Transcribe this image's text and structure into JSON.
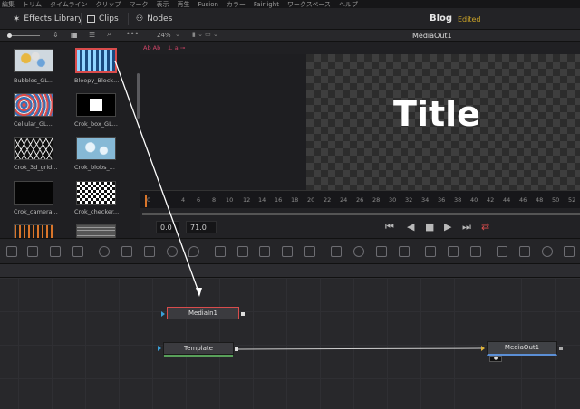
{
  "menu": [
    "編集",
    "トリム",
    "タイムライン",
    "クリップ",
    "マーク",
    "表示",
    "再生",
    "Fusion",
    "カラー",
    "Fairlight",
    "ワークスペース",
    "ヘルプ"
  ],
  "toolbar": {
    "effects_library": "Effects Library",
    "clips": "Clips",
    "nodes": "Nodes",
    "project_name": "Blog",
    "status": "Edited"
  },
  "library": {
    "items": [
      {
        "label": "Bubbles_GL..."
      },
      {
        "label": "Bleepy_Block..."
      },
      {
        "label": "Cellular_GL..."
      },
      {
        "label": "Crok_box_GL..."
      },
      {
        "label": "Crok_3d_grid..."
      },
      {
        "label": "Crok_blobs_..."
      },
      {
        "label": "Crok_camera..."
      },
      {
        "label": "Crok_checker..."
      }
    ]
  },
  "viewer": {
    "zoom": "24%",
    "node_name": "MediaOut1",
    "overlay_label": "Ab Ab",
    "title_text": "Title"
  },
  "ruler": {
    "ticks": [
      "0",
      "4",
      "6",
      "8",
      "10",
      "12",
      "14",
      "16",
      "18",
      "20",
      "22",
      "24",
      "26",
      "28",
      "30",
      "32",
      "34",
      "36",
      "38",
      "40",
      "42",
      "44",
      "46",
      "48",
      "50",
      "52"
    ]
  },
  "transport": {
    "current_frame": "0.0",
    "end_frame": "71.0"
  },
  "nodes": {
    "media_in": "MediaIn1",
    "template": "Template",
    "media_out": "MediaOut1"
  },
  "colors": {
    "accent_red": "#d94c4c",
    "edited_gold": "#c9a227",
    "output_blue": "#5b8fd6"
  }
}
